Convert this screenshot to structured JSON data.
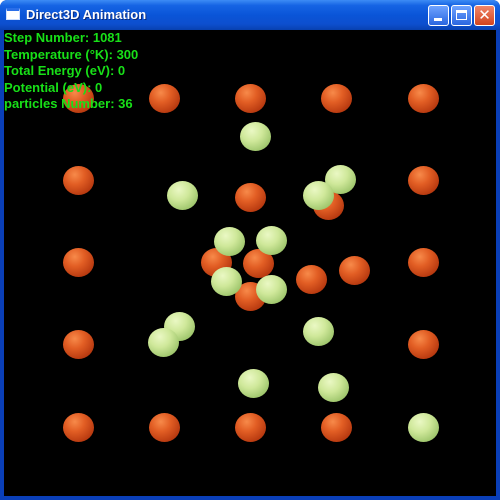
{
  "window": {
    "title": "Direct3D Animation",
    "icons": {
      "app": "window-app-icon",
      "minimize": "minimize-icon",
      "maximize": "maximize-icon",
      "close": "close-icon"
    },
    "colors": {
      "titlebar": "#0a55d8",
      "background": "#000000",
      "stats_text": "#18e018"
    }
  },
  "stats": {
    "step": "Step Number: 1081",
    "temperature": "Temperature (°K): 300",
    "total_energy": "Total Energy (eV): 0",
    "potential": "Potential (eV): 0",
    "particles": "particles Number: 36"
  },
  "scene": {
    "particles": [
      {
        "type": "red"
      },
      {
        "type": "red"
      },
      {
        "type": "red"
      },
      {
        "type": "red"
      },
      {
        "type": "red"
      },
      {
        "type": "red"
      },
      {
        "type": "red"
      },
      {
        "type": "red"
      },
      {
        "type": "red"
      },
      {
        "type": "red"
      },
      {
        "type": "red"
      },
      {
        "type": "red"
      },
      {
        "type": "red"
      },
      {
        "type": "red"
      },
      {
        "type": "red"
      },
      {
        "type": "red"
      },
      {
        "type": "red"
      },
      {
        "type": "red"
      },
      {
        "type": "red"
      },
      {
        "type": "red"
      },
      {
        "type": "red"
      },
      {
        "type": "red"
      },
      {
        "type": "green"
      },
      {
        "type": "green"
      },
      {
        "type": "green"
      },
      {
        "type": "green"
      },
      {
        "type": "green"
      },
      {
        "type": "green"
      },
      {
        "type": "green"
      },
      {
        "type": "green"
      },
      {
        "type": "green"
      },
      {
        "type": "green"
      },
      {
        "type": "green"
      },
      {
        "type": "green"
      },
      {
        "type": "green"
      },
      {
        "type": "green"
      }
    ]
  }
}
